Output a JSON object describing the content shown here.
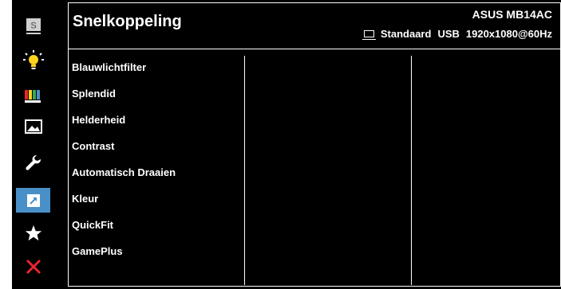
{
  "header": {
    "title": "Snelkoppeling",
    "model": "ASUS MB14AC",
    "status": {
      "mode": "Standaard",
      "input": "USB",
      "resolution": "1920x1080@60Hz"
    }
  },
  "sidebar": {
    "items": [
      {
        "icon": "s-logo-icon"
      },
      {
        "icon": "bulb-icon"
      },
      {
        "icon": "color-bars-icon"
      },
      {
        "icon": "image-icon"
      },
      {
        "icon": "wrench-icon"
      },
      {
        "icon": "shortcut-arrow-icon",
        "active": true
      },
      {
        "icon": "star-icon"
      },
      {
        "icon": "close-icon"
      }
    ]
  },
  "menu": {
    "items": [
      "Blauwlichtfilter",
      "Splendid",
      "Helderheid",
      "Contrast",
      "Automatisch Draaien",
      "Kleur",
      "QuickFit",
      "GamePlus"
    ]
  },
  "colors": {
    "accent": "#4a90c8",
    "close": "#e8262e",
    "bulb": "#ffd21c"
  }
}
